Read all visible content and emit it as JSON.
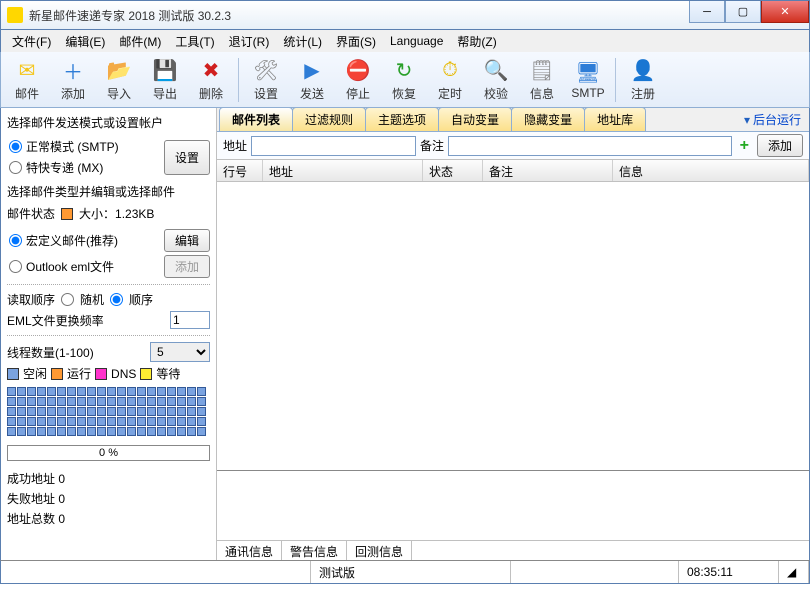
{
  "title": "新星邮件速递专家 2018 测试版 30.2.3",
  "menu": [
    "文件(F)",
    "编辑(E)",
    "邮件(M)",
    "工具(T)",
    "退订(R)",
    "统计(L)",
    "界面(S)",
    "Language",
    "帮助(Z)"
  ],
  "toolbar": [
    {
      "label": "邮件",
      "icon": "✉",
      "color": "#f5c518"
    },
    {
      "label": "添加",
      "icon": "＋",
      "color": "#2e7dd7"
    },
    {
      "label": "导入",
      "icon": "📂",
      "color": "#e6b800"
    },
    {
      "label": "导出",
      "icon": "💾",
      "color": "#2e7dd7"
    },
    {
      "label": "删除",
      "icon": "✖",
      "color": "#d02020"
    },
    {
      "sep": true
    },
    {
      "label": "设置",
      "icon": "🛠",
      "color": "#888"
    },
    {
      "label": "发送",
      "icon": "▶",
      "color": "#2e7dd7"
    },
    {
      "label": "停止",
      "icon": "⛔",
      "color": "#d02020"
    },
    {
      "label": "恢复",
      "icon": "↻",
      "color": "#2aa02a"
    },
    {
      "label": "定时",
      "icon": "⏱",
      "color": "#e6b800"
    },
    {
      "label": "校验",
      "icon": "🔍",
      "color": "#2e7dd7"
    },
    {
      "label": "信息",
      "icon": "🗒",
      "color": "#888"
    },
    {
      "label": "SMTP",
      "icon": "🖥",
      "color": "#2e7dd7"
    },
    {
      "sep": true
    },
    {
      "label": "注册",
      "icon": "👤",
      "color": "#2e7dd7"
    }
  ],
  "sidebar": {
    "sec1_title": "选择邮件发送模式或设置帐户",
    "mode_normal": "正常模式 (SMTP)",
    "mode_express": "特快专递 (MX)",
    "settings_btn": "设置",
    "sec2_title": "选择邮件类型并编辑或选择邮件",
    "mail_status_label": "邮件状态",
    "size_label": "大小：1.23KB",
    "macro_label": "宏定义邮件(推荐)",
    "edit_btn": "编辑",
    "outlook_label": "Outlook eml文件",
    "outlook_btn": "添加",
    "read_order": "读取顺序",
    "order_random": "随机",
    "order_seq": "顺序",
    "eml_freq_label": "EML文件更换频率",
    "eml_freq_val": "1",
    "thread_label": "线程数量(1-100)",
    "thread_val": "5",
    "leg_idle": "空闲",
    "leg_run": "运行",
    "leg_dns": "DNS",
    "leg_wait": "等待",
    "progress": "0 %",
    "succ": "成功地址  0",
    "fail": "失败地址  0",
    "total": "地址总数  0"
  },
  "content": {
    "tabs": [
      "邮件列表",
      "过滤规则",
      "主题选项",
      "自动变量",
      "隐藏变量",
      "地址库"
    ],
    "bg_run": "后台运行",
    "addr_label": "地址",
    "note_label": "备注",
    "add_btn": "添加",
    "cols": {
      "rownum": "行号",
      "addr": "地址",
      "status": "状态",
      "note": "备注",
      "info": "信息"
    },
    "btabs": [
      "通讯信息",
      "警告信息",
      "回测信息"
    ]
  },
  "status": {
    "mid": "测试版",
    "time": "08:35:11"
  }
}
